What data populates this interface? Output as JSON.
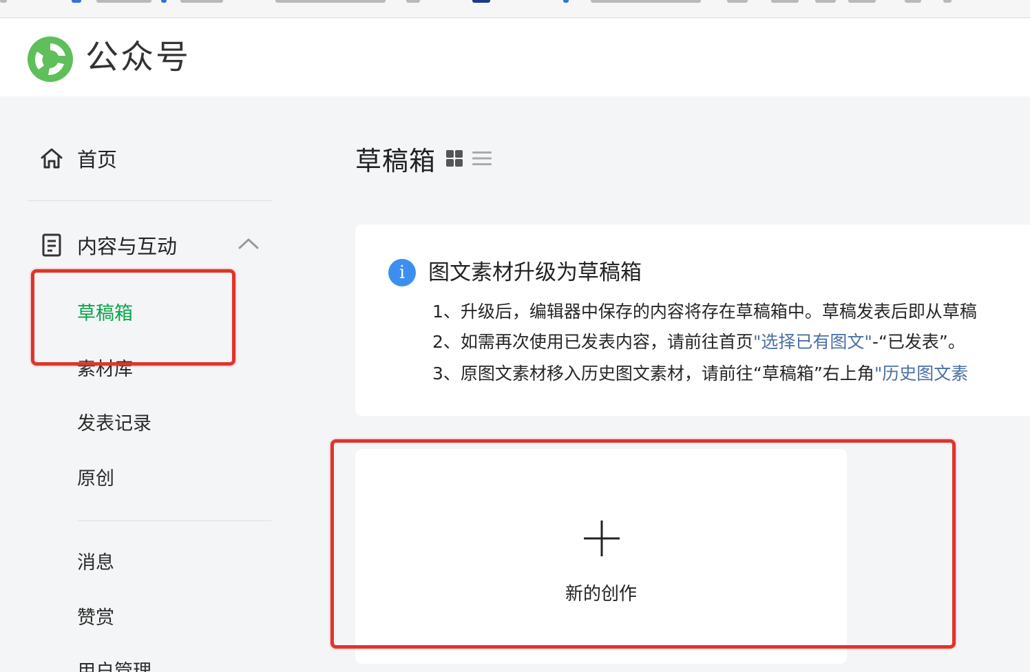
{
  "header": {
    "title": "公众号"
  },
  "sidebar": {
    "home": "首页",
    "content_section": "内容与互动",
    "items": [
      "草稿箱",
      "素材库",
      "发表记录",
      "原创"
    ],
    "items_2": [
      "消息",
      "赞赏",
      "用户管理"
    ],
    "active_item": "草稿箱",
    "active_color": "#07a54a"
  },
  "main": {
    "page_title": "草稿箱",
    "notice": {
      "title": "图文素材升级为草稿箱",
      "line1": "1、升级后，编辑器中保存的内容将存在草稿箱中。草稿发表后即从草稿",
      "line2_prefix": "2、如需再次使用已发表内容，请前往首页",
      "line2_link": "\"选择已有图文\"",
      "line2_suffix": "-“已发表”。",
      "line3_prefix": "3、原图文素材移入历史图文素材，请前往“草稿箱”右上角",
      "line3_link": "\"历史图文素"
    },
    "new_card_label": "新的创作"
  },
  "colors": {
    "brand_green": "#07a54a",
    "info_blue": "#3d8ef0",
    "link_blue": "#4a6fa5",
    "annotation_red": "#e0352b"
  }
}
